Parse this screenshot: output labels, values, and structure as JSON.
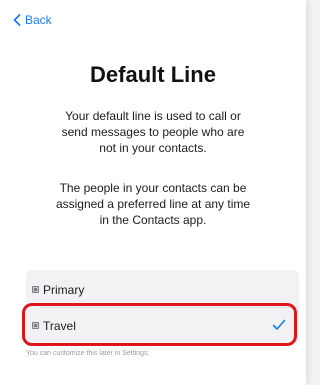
{
  "nav": {
    "back_label": "Back"
  },
  "page": {
    "title": "Default Line",
    "paragraph_1": "Your default line is used to call or send messages to people who are not in your contacts.",
    "paragraph_2": "The people in your contacts can be assigned a preferred line at any time in the Contacts app."
  },
  "options": [
    {
      "label": "Primary",
      "selected": false
    },
    {
      "label": "Travel",
      "selected": true
    }
  ],
  "footnote": "You can customize this later in Settings.",
  "colors": {
    "accent": "#1a7cf4",
    "highlight": "#e0151a"
  },
  "icons": {
    "back": "chevron-left-icon",
    "sim": "sim-card-icon",
    "check": "checkmark-icon"
  }
}
